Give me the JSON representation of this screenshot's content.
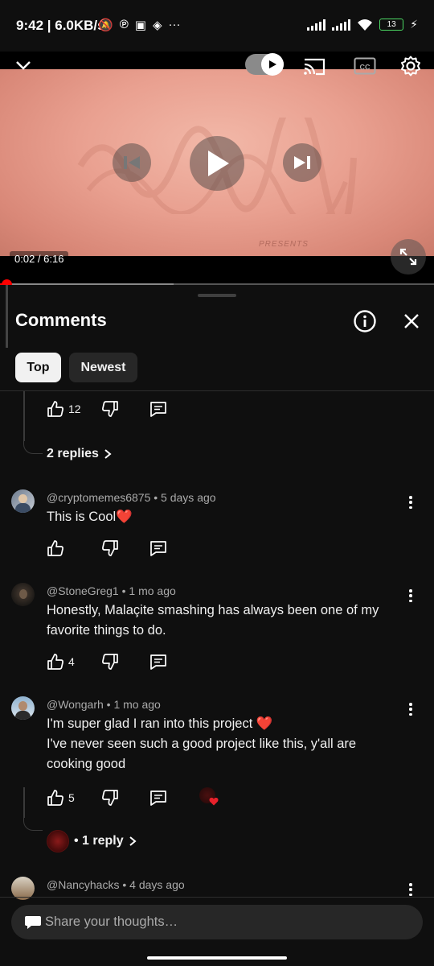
{
  "status_bar": {
    "time": "9:42",
    "speed": "6.0KB/s",
    "battery": "13",
    "notif_icons": [
      "mute-bell-icon",
      "pinterest-icon",
      "app-icon",
      "binance-icon",
      "more-dots-icon"
    ]
  },
  "video": {
    "timecode": "0:02 / 6:16",
    "presents_text": "PRESENTS",
    "progress_fraction": 0.005,
    "buffer_fraction": 0.4,
    "autoplay_on": true
  },
  "comments_panel": {
    "title": "Comments",
    "chips": {
      "top": "Top",
      "newest": "Newest"
    },
    "selected_chip": "Top"
  },
  "partial_comment": {
    "likes": "12",
    "replies_label": "2 replies"
  },
  "comments": [
    {
      "author": "@cryptomemes6875",
      "time": "5 days ago",
      "meta": "@cryptomemes6875 • 5 days ago",
      "text": "This is Cool❤️",
      "likes": ""
    },
    {
      "author": "@StoneGreg1",
      "time": "1 mo ago",
      "meta": "@StoneGreg1 • 1 mo ago",
      "text": "Honestly, Malaçite smashing has always been one of my favorite things to do.",
      "likes": "4"
    },
    {
      "author": "@Wongarh",
      "time": "1 mo ago",
      "meta": "@Wongarh • 1 mo ago",
      "text_line1": "I'm super glad I ran into this project ❤️",
      "text_line2": "I've never seen such a good project like this, y'all are cooking good",
      "likes": "5",
      "reply_label": "• 1 reply"
    },
    {
      "author": "@Nancyhacks",
      "time": "4 days ago",
      "meta": "@Nancyhacks • 4 days ago"
    }
  ],
  "composer": {
    "placeholder": "Share your thoughts…"
  },
  "colors": {
    "background": "#0f0f0f",
    "chip_active": "#f1f1f1",
    "chip_inactive": "#272727",
    "progress": "#ff0000",
    "heart": "#e8212b"
  }
}
